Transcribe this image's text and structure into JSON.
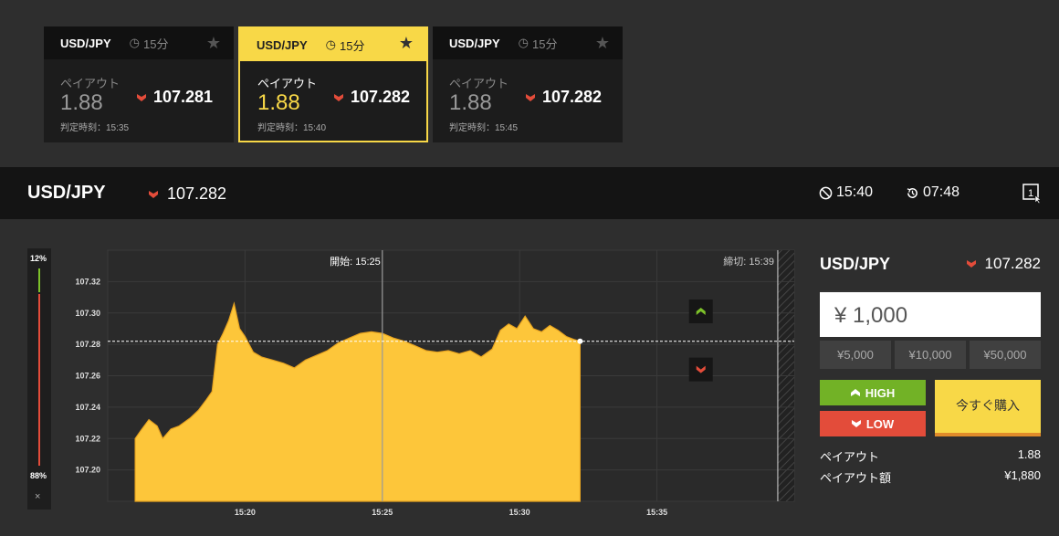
{
  "cards": [
    {
      "pair": "USD/JPY",
      "duration": "15分",
      "payout_label": "ペイアウト",
      "payout": "1.88",
      "price": "107.281",
      "judge": "判定時刻：15:35",
      "active": false
    },
    {
      "pair": "USD/JPY",
      "duration": "15分",
      "payout_label": "ペイアウト",
      "payout": "1.88",
      "price": "107.282",
      "judge": "判定時刻：15:40",
      "active": true
    },
    {
      "pair": "USD/JPY",
      "duration": "15分",
      "payout_label": "ペイアウト",
      "payout": "1.88",
      "price": "107.282",
      "judge": "判定時刻：15:45",
      "active": false
    }
  ],
  "header": {
    "pair": "USD/JPY",
    "price": "107.282",
    "close_time": "15:40",
    "remaining": "07:48",
    "expand_label": "1"
  },
  "ratio": {
    "high_pct": "12%",
    "low_pct": "88%",
    "high_value": 12,
    "low_value": 88,
    "close": "×"
  },
  "chart_data": {
    "type": "area",
    "start_label": "開始: 15:25",
    "end_label": "締切: 15:39",
    "y_ticks": [
      "107.32",
      "107.30",
      "107.28",
      "107.26",
      "107.24",
      "107.22",
      "107.20"
    ],
    "x_ticks": [
      "15:20",
      "15:25",
      "15:30",
      "15:35"
    ],
    "current_level": 107.282,
    "ylim": [
      107.18,
      107.34
    ],
    "xlim_minutes": [
      15.0,
      40.0
    ],
    "x": [
      16.0,
      16.2,
      16.5,
      16.8,
      17.0,
      17.3,
      17.6,
      18.0,
      18.3,
      18.6,
      18.8,
      19.0,
      19.2,
      19.4,
      19.6,
      19.8,
      20.0,
      20.3,
      20.6,
      21.0,
      21.4,
      21.8,
      22.2,
      22.6,
      23.0,
      23.4,
      23.8,
      24.2,
      24.6,
      25.0,
      25.4,
      25.8,
      26.2,
      26.6,
      27.0,
      27.4,
      27.8,
      28.2,
      28.6,
      29.0,
      29.3,
      29.6,
      29.9,
      30.2,
      30.5,
      30.8,
      31.1,
      31.4,
      31.7,
      32.0,
      32.2
    ],
    "values": [
      107.22,
      107.225,
      107.232,
      107.228,
      107.22,
      107.226,
      107.228,
      107.233,
      107.238,
      107.245,
      107.25,
      107.28,
      107.287,
      107.295,
      107.306,
      107.29,
      107.285,
      107.275,
      107.272,
      107.27,
      107.268,
      107.265,
      107.27,
      107.273,
      107.276,
      107.281,
      107.284,
      107.287,
      107.288,
      107.287,
      107.284,
      107.282,
      107.279,
      107.276,
      107.275,
      107.276,
      107.274,
      107.276,
      107.272,
      107.277,
      107.289,
      107.293,
      107.29,
      107.298,
      107.29,
      107.288,
      107.292,
      107.289,
      107.285,
      107.283,
      107.282
    ]
  },
  "panel": {
    "pair": "USD/JPY",
    "price": "107.282",
    "amount": "¥ 1,000",
    "quick": [
      "¥5,000",
      "¥10,000",
      "¥50,000"
    ],
    "high_label": "HIGH",
    "low_label": "LOW",
    "buy_label": "今すぐ購入",
    "payout_label": "ペイアウト",
    "payout_value": "1.88",
    "payout_amount_label": "ペイアウト額",
    "payout_amount_value": "¥1,880"
  },
  "colors": {
    "accent": "#f8d847",
    "high": "#72b226",
    "low": "#e34c3a"
  }
}
